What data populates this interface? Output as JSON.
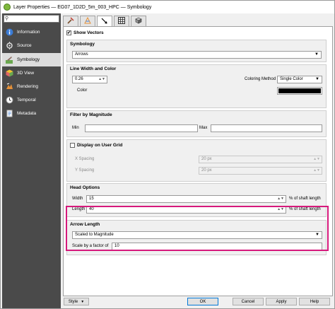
{
  "window": {
    "title": "Layer Properties — EG07_1D2D_5m_003_HPC — Symbology"
  },
  "sidebar": {
    "search_icon": "magnifier-icon",
    "items": [
      {
        "label": "Information",
        "icon": "info-icon"
      },
      {
        "label": "Source",
        "icon": "source-icon"
      },
      {
        "label": "Symbology",
        "icon": "paintbrush-icon"
      },
      {
        "label": "3D View",
        "icon": "cube-icon"
      },
      {
        "label": "Rendering",
        "icon": "rendering-icon"
      },
      {
        "label": "Temporal",
        "icon": "clock-icon"
      },
      {
        "label": "Metadata",
        "icon": "metadata-icon"
      }
    ],
    "active": "Symbology"
  },
  "tabs": [
    {
      "icon": "hammer-icon"
    },
    {
      "icon": "contour-icon"
    },
    {
      "icon": "vector-arrow-icon"
    },
    {
      "icon": "grid-icon"
    },
    {
      "icon": "mesh-3d-icon"
    }
  ],
  "show_vectors": {
    "label": "Show Vectors",
    "checked": true
  },
  "symbology": {
    "title": "Symbology",
    "value": "Arrows"
  },
  "line_width_color": {
    "title": "Line Width and Color",
    "width": "0.26",
    "coloring_method_label": "Coloring Method",
    "coloring_method": "Single Color",
    "color_label": "Color",
    "color": "#000000"
  },
  "filter": {
    "title": "Filter by Magnitude",
    "min_label": "Min",
    "max_label": "Max",
    "min": "",
    "max": ""
  },
  "user_grid": {
    "label": "Display on User Grid",
    "checked": false,
    "x_label": "X Spacing",
    "x_value": "20 px",
    "y_label": "Y Spacing",
    "y_value": "20 px"
  },
  "head_options": {
    "title": "Head Options",
    "width_label": "Width",
    "width": "15",
    "width_unit": "% of shaft length",
    "length_label": "Length",
    "length": "40",
    "length_unit": "% of shaft length"
  },
  "arrow_length": {
    "title": "Arrow Length",
    "method": "Scaled to Magnitude",
    "scale_label": "Scale by a factor of",
    "scale": "10"
  },
  "buttons": {
    "style": "Style",
    "ok": "OK",
    "cancel": "Cancel",
    "apply": "Apply",
    "help": "Help"
  },
  "colors": {
    "highlight": "#d6197c",
    "sidebar_bg": "#4a4a4a"
  }
}
